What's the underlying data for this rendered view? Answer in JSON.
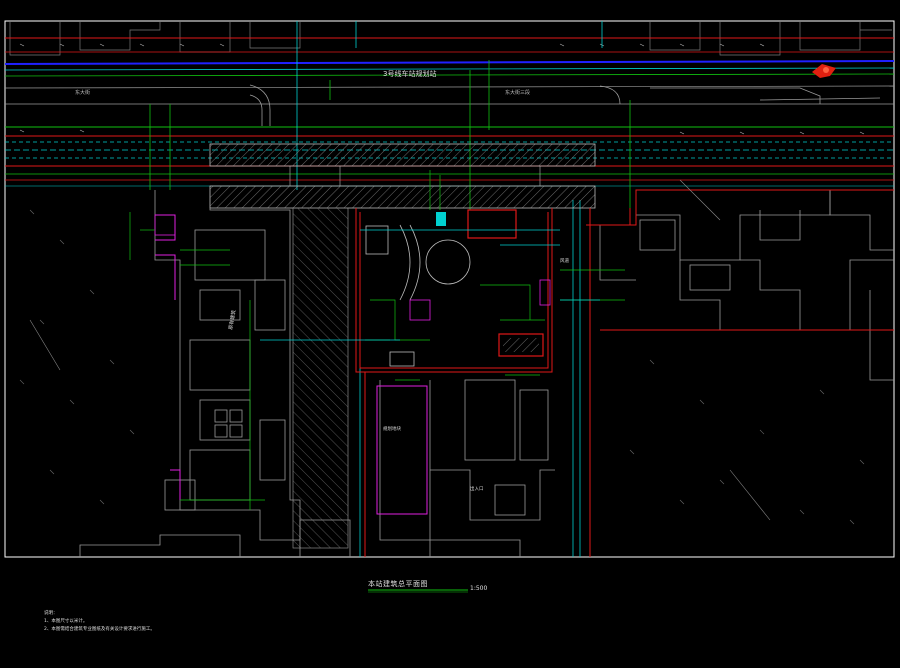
{
  "drawing": {
    "title": "本站建筑总平面图",
    "scale": "1:500",
    "notes_heading": "说明：",
    "notes": [
      "1、本图尺寸以米计。",
      "2、本图需结合建筑专业图纸及有关设计要求进行施工。"
    ]
  },
  "labels": {
    "station_name": "3号线车站规划站",
    "road_left": "东大街",
    "road_right": "东大街三段",
    "plot_left": "原有建筑",
    "plot_center": "规划地块",
    "entrance": "出入口",
    "duct_label": "风道"
  },
  "colors": {
    "background": "#000000",
    "frame": "#ffffff",
    "red_line": "#e01818",
    "green_line": "#10c010",
    "cyan_line": "#00d0d0",
    "blue_line": "#2020ff",
    "magenta_line": "#e020e0",
    "gray_line": "#9a9a9a"
  }
}
